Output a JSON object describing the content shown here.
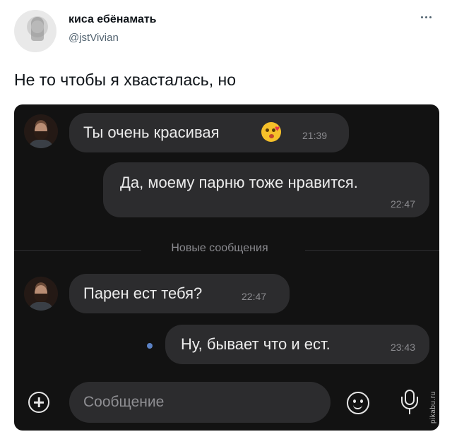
{
  "tweet": {
    "author_name": "киса ебёнамать",
    "author_handle": "@jstVivian",
    "text": "Не то чтобы я хвасталась, но"
  },
  "chat": {
    "messages": [
      {
        "sender": "incoming",
        "text": "Ты  очень красивая",
        "emoji": "kissing-face-icon",
        "time": "21:39"
      },
      {
        "sender": "outgoing",
        "text": "Да, моему парню тоже нравится.",
        "time": "22:47"
      },
      {
        "sender": "incoming",
        "text": "Парен ест тебя?",
        "time": "22:47"
      },
      {
        "sender": "outgoing",
        "text": "Ну, бывает что и ест.",
        "time": "23:43",
        "status": "unread"
      }
    ],
    "new_messages_label": "Новые сообщения",
    "composer": {
      "placeholder": "Сообщение",
      "icons": [
        "plus-icon",
        "smile-icon",
        "mic-icon"
      ]
    }
  },
  "watermark": "pikabu.ru",
  "colors": {
    "chat_background": "#121212",
    "bubble": "#2c2c2e",
    "unread_dot": "#5b82c5"
  }
}
